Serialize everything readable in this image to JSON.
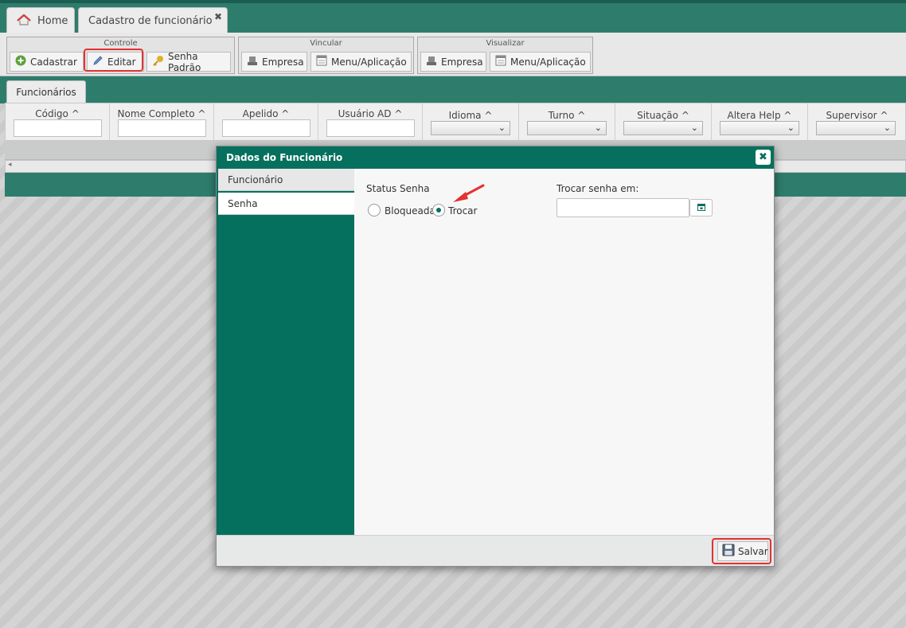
{
  "tabs": [
    {
      "label": "Home",
      "icon": "home-icon"
    },
    {
      "label": "Cadastro de funcionário",
      "close": "✖"
    }
  ],
  "toolbar": {
    "groups": [
      {
        "title": "Controle",
        "buttons": [
          "Cadastrar",
          "Editar",
          "Senha Padrão"
        ]
      },
      {
        "title": "Vincular",
        "buttons": [
          "Empresa",
          "Menu/Aplicação"
        ]
      },
      {
        "title": "Visualizar",
        "buttons": [
          "Empresa",
          "Menu/Aplicação"
        ]
      }
    ],
    "highlighted_button": "Editar"
  },
  "grid": {
    "tab_label": "Funcionários",
    "columns": [
      "Código",
      "Nome Completo",
      "Apelido",
      "Usuário AD",
      "Idioma",
      "Turno",
      "Situação",
      "Altera Help",
      "Supervisor"
    ],
    "sort_glyph": "^"
  },
  "dialog": {
    "title": "Dados do Funcionário",
    "close_glyph": "✖",
    "side_tabs": [
      "Funcionário",
      "Senha"
    ],
    "status_label": "Status Senha",
    "radio_options": [
      "Bloqueada",
      "Trocar"
    ],
    "selected_option": "Trocar",
    "date_label": "Trocar senha em:",
    "date_value": "",
    "save_label": "Salvar"
  },
  "colors": {
    "brand_green": "#05705e",
    "bar_green": "#2e7c6c",
    "highlight_red": "#e23232"
  }
}
